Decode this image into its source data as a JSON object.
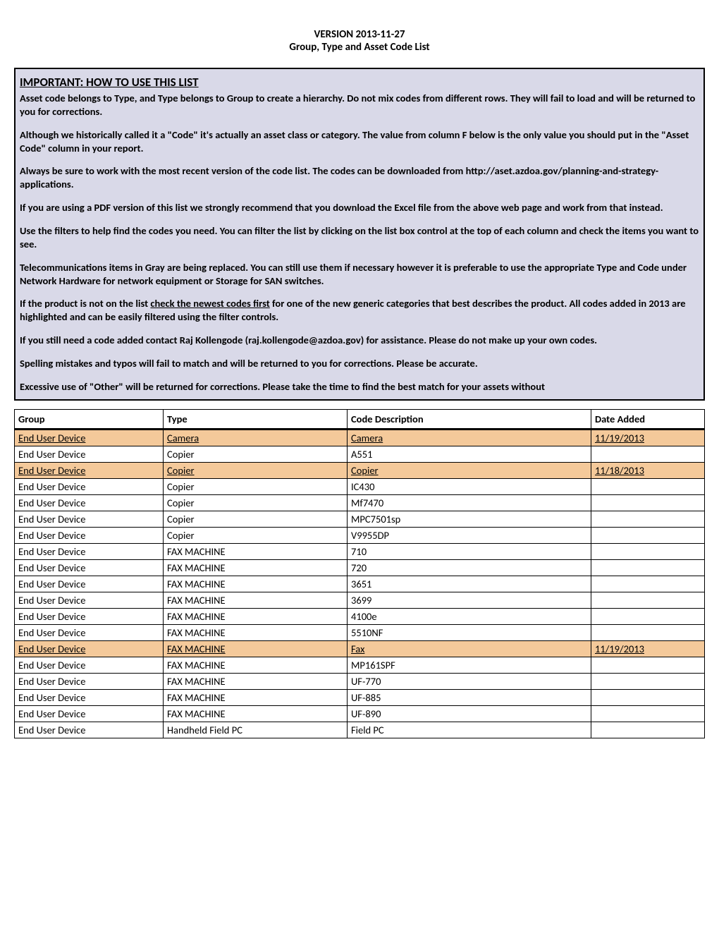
{
  "header": {
    "line1": "VERSION 2013-11-27",
    "line2": "Group, Type and Asset Code List"
  },
  "info": {
    "title": "IMPORTANT: HOW TO USE THIS LIST",
    "p1": "Asset code belongs to Type, and Type belongs to Group to create a hierarchy. Do not mix codes from different rows. They will fail to load and will be returned to you for corrections.",
    "p2": "Although we historically called it a \"Code\" it's actually an asset class or category. The value from column F below is the only value you should put in the \"Asset Code\" column in your report.",
    "p3": "Always be sure to work with the most recent version of the code list. The codes can be downloaded from http://aset.azdoa.gov/planning-and-strategy-applications.",
    "p4": "If you are using a PDF version of this list we strongly recommend that you download the Excel file from the above web page and work from that instead.",
    "p5": "Use the filters to help find the codes you need. You can filter the list by clicking on the list box control at the top of each column and check the items you want to see.",
    "p6": "Telecommunications items in Gray are being replaced. You can still use them if necessary however it is preferable to use the appropriate Type and Code under Network Hardware for network equipment or Storage for SAN switches.",
    "p7a": "If the product is not on the list ",
    "p7u": "check the newest codes first",
    "p7b": " for one of the new generic categories that best describes the product. All codes added in 2013 are highlighted and can be easily filtered using the filter controls.",
    "p8": "If you still need a code added contact Raj Kollengode (raj.kollengode@azdoa.gov) for assistance. Please do not make up your own codes.",
    "p9": "Spelling mistakes and typos will fail to match and will be returned to you for corrections. Please be accurate.",
    "p10": "Excessive use of \"Other\" will be returned for corrections. Please take the time to find the best match for your assets without"
  },
  "table": {
    "headers": {
      "group": "Group",
      "type": "Type",
      "desc": "Code Description",
      "date": "Date Added"
    },
    "rows": [
      {
        "group": "End User Device",
        "type": "Camera",
        "desc": "Camera",
        "date": "11/19/2013",
        "hl": true
      },
      {
        "group": "End User Device",
        "type": "Copier",
        "desc": "A551",
        "date": "",
        "hl": false
      },
      {
        "group": "End User Device",
        "type": "Copier",
        "desc": "Copier",
        "date": "11/18/2013",
        "hl": true
      },
      {
        "group": "End User Device",
        "type": "Copier",
        "desc": "IC430",
        "date": "",
        "hl": false
      },
      {
        "group": "End User Device",
        "type": "Copier",
        "desc": "Mf7470",
        "date": "",
        "hl": false
      },
      {
        "group": "End User Device",
        "type": "Copier",
        "desc": "MPC7501sp",
        "date": "",
        "hl": false
      },
      {
        "group": "End User Device",
        "type": "Copier",
        "desc": "V9955DP",
        "date": "",
        "hl": false
      },
      {
        "group": "End User Device",
        "type": "FAX MACHINE",
        "desc": "710",
        "date": "",
        "hl": false
      },
      {
        "group": "End User Device",
        "type": "FAX MACHINE",
        "desc": "720",
        "date": "",
        "hl": false
      },
      {
        "group": "End User Device",
        "type": "FAX MACHINE",
        "desc": "3651",
        "date": "",
        "hl": false
      },
      {
        "group": "End User Device",
        "type": "FAX MACHINE",
        "desc": "3699",
        "date": "",
        "hl": false
      },
      {
        "group": "End User Device",
        "type": "FAX MACHINE",
        "desc": "4100e",
        "date": "",
        "hl": false
      },
      {
        "group": "End User Device",
        "type": "FAX MACHINE",
        "desc": "5510NF",
        "date": "",
        "hl": false
      },
      {
        "group": "End User Device",
        "type": "FAX MACHINE",
        "desc": "Fax",
        "date": "11/19/2013",
        "hl": true
      },
      {
        "group": "End User Device",
        "type": "FAX MACHINE",
        "desc": "MP161SPF",
        "date": "",
        "hl": false
      },
      {
        "group": "End User Device",
        "type": "FAX MACHINE",
        "desc": "UF-770",
        "date": "",
        "hl": false
      },
      {
        "group": "End User Device",
        "type": "FAX MACHINE",
        "desc": "UF-885",
        "date": "",
        "hl": false
      },
      {
        "group": "End User Device",
        "type": "FAX MACHINE",
        "desc": "UF-890",
        "date": "",
        "hl": false
      },
      {
        "group": "End User Device",
        "type": "Handheld Field PC",
        "desc": "Field PC",
        "date": "",
        "hl": false
      }
    ]
  }
}
